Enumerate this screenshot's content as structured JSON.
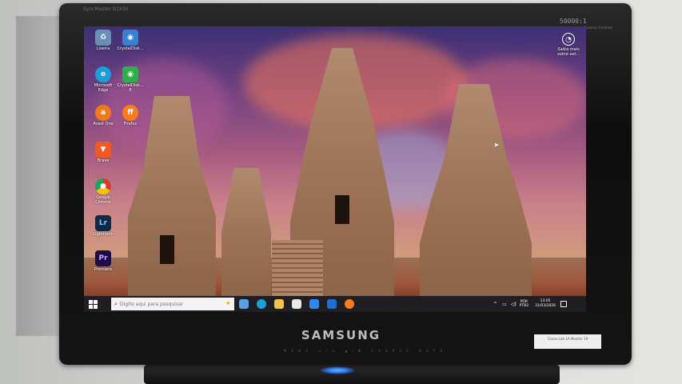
{
  "monitor": {
    "brand": "SAMSUNG",
    "model_label": "SyncMaster B1930",
    "contrast_label": "50000:1",
    "contrast_sub": "Dynamic Contrast",
    "button_labels": "MENU ⊙/⊙ ▲/▼ SOURCE AUTO",
    "sticker": "Classe\nLab 1A Monitor 19"
  },
  "desktop": {
    "icons": [
      {
        "label": "Lixeira",
        "icon": "recycle-bin-icon",
        "color": "#6b8fb4"
      },
      {
        "label": "CrystalDisk...",
        "icon": "crystaldisk-icon",
        "color": "#3a7fd1"
      },
      {
        "label": "Microsoft Edge",
        "icon": "edge-icon",
        "color": "#1a9fd8"
      },
      {
        "label": "CrystalDisk... 8",
        "icon": "crystaldisk-mark-icon",
        "color": "#2fae4a"
      },
      {
        "label": "Avast One",
        "icon": "avast-icon",
        "color": "#f07a1a"
      },
      {
        "label": "Firefox",
        "icon": "firefox-icon",
        "color": "#ff7a1a"
      },
      {
        "label": "Brave",
        "icon": "brave-icon",
        "color": "#f05a22"
      },
      {
        "label": "Google Chrome",
        "icon": "chrome-icon",
        "color": "#d93b30"
      },
      {
        "label": "Lightroom",
        "icon": "lightroom-icon",
        "color": "#0f2a44"
      },
      {
        "label": "Premiere",
        "icon": "premiere-icon",
        "color": "#1e0b4a"
      }
    ],
    "learn_more": {
      "label": "Saiba mais sobre est...",
      "icon": "camera-icon"
    }
  },
  "taskbar": {
    "search_placeholder": "Digite aqui para pesquisar",
    "apps": [
      {
        "icon": "news-icon",
        "color": "#5aa0e6"
      },
      {
        "icon": "edge-icon",
        "color": "#1a9fd8"
      },
      {
        "icon": "folder-icon",
        "color": "#f2c14e"
      },
      {
        "icon": "calendar-icon",
        "color": "#e8e8e8"
      },
      {
        "icon": "store-icon",
        "color": "#2d89ef"
      },
      {
        "icon": "mail-icon",
        "color": "#1f6fd0"
      },
      {
        "icon": "firefox-icon",
        "color": "#ff7a1a"
      }
    ],
    "tray": {
      "chevron": "^",
      "lang_line1": "POR",
      "lang_line2": "PTB2",
      "time": "13:05",
      "date": "31/03/2026"
    }
  }
}
